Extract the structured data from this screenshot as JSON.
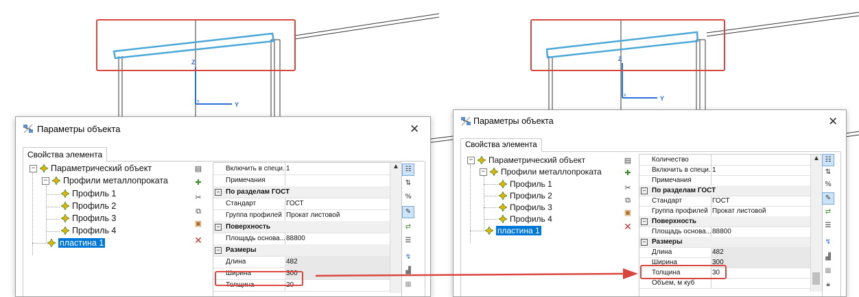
{
  "colors": {
    "highlight": "#d9463d",
    "beam": "#4aa8d8",
    "axis": "#2a6fd6",
    "selection": "#0078d7"
  },
  "axes": {
    "z": "Z",
    "y": "Y"
  },
  "left": {
    "dialog_title": "Параметры объекта",
    "close_glyph": "✕",
    "tab": "Свойства элемента",
    "tree": {
      "root": "Параметрический объект",
      "group": "Профили металлопроката",
      "profiles": [
        "Профиль 1",
        "Профиль 2",
        "Профиль 3",
        "Профиль 4"
      ],
      "plate": "пластина 1"
    },
    "props": {
      "include_key": "Включить в специ...",
      "include_val": "1",
      "notes_key": "Примечания",
      "cat_gost": "По разделам ГОСТ",
      "standard_key": "Стандарт",
      "standard_val": "ГОСТ",
      "group_key": "Группа профилей",
      "group_val": "Прокат листовой",
      "cat_surface": "Поверхность",
      "area_key": "Площадь основа...",
      "area_val": "88800",
      "cat_size": "Размеры",
      "length_key": "Длина",
      "length_val": "482",
      "width_key": "Ширина",
      "width_val": "300",
      "thick_key": "Толщина",
      "thick_val": "20"
    }
  },
  "right": {
    "dialog_title": "Параметры объекта",
    "close_glyph": "✕",
    "tab": "Свойства элемента",
    "tree": {
      "root": "Параметрический объект",
      "group": "Профили металлопроката",
      "profiles": [
        "Профиль 1",
        "Профиль 2",
        "Профиль 3",
        "Профиль 4"
      ],
      "plate": "пластина 1"
    },
    "props": {
      "qty_key": "Количество",
      "include_key": "Включить в специ...",
      "include_val": "1",
      "notes_key": "Примечания",
      "cat_gost": "По разделам ГОСТ",
      "standard_key": "Стандарт",
      "standard_val": "ГОСТ",
      "group_key": "Группа профилей",
      "group_val": "Прокат листовой",
      "cat_surface": "Поверхность",
      "area_key": "Площадь основа...",
      "area_val": "88800",
      "cat_size": "Размеры",
      "length_key": "Длина",
      "length_val": "482",
      "width_key": "Ширина",
      "width_val": "300",
      "thick_key": "Толщина",
      "thick_val": "30",
      "volume_key": "Объем, м куб"
    }
  }
}
